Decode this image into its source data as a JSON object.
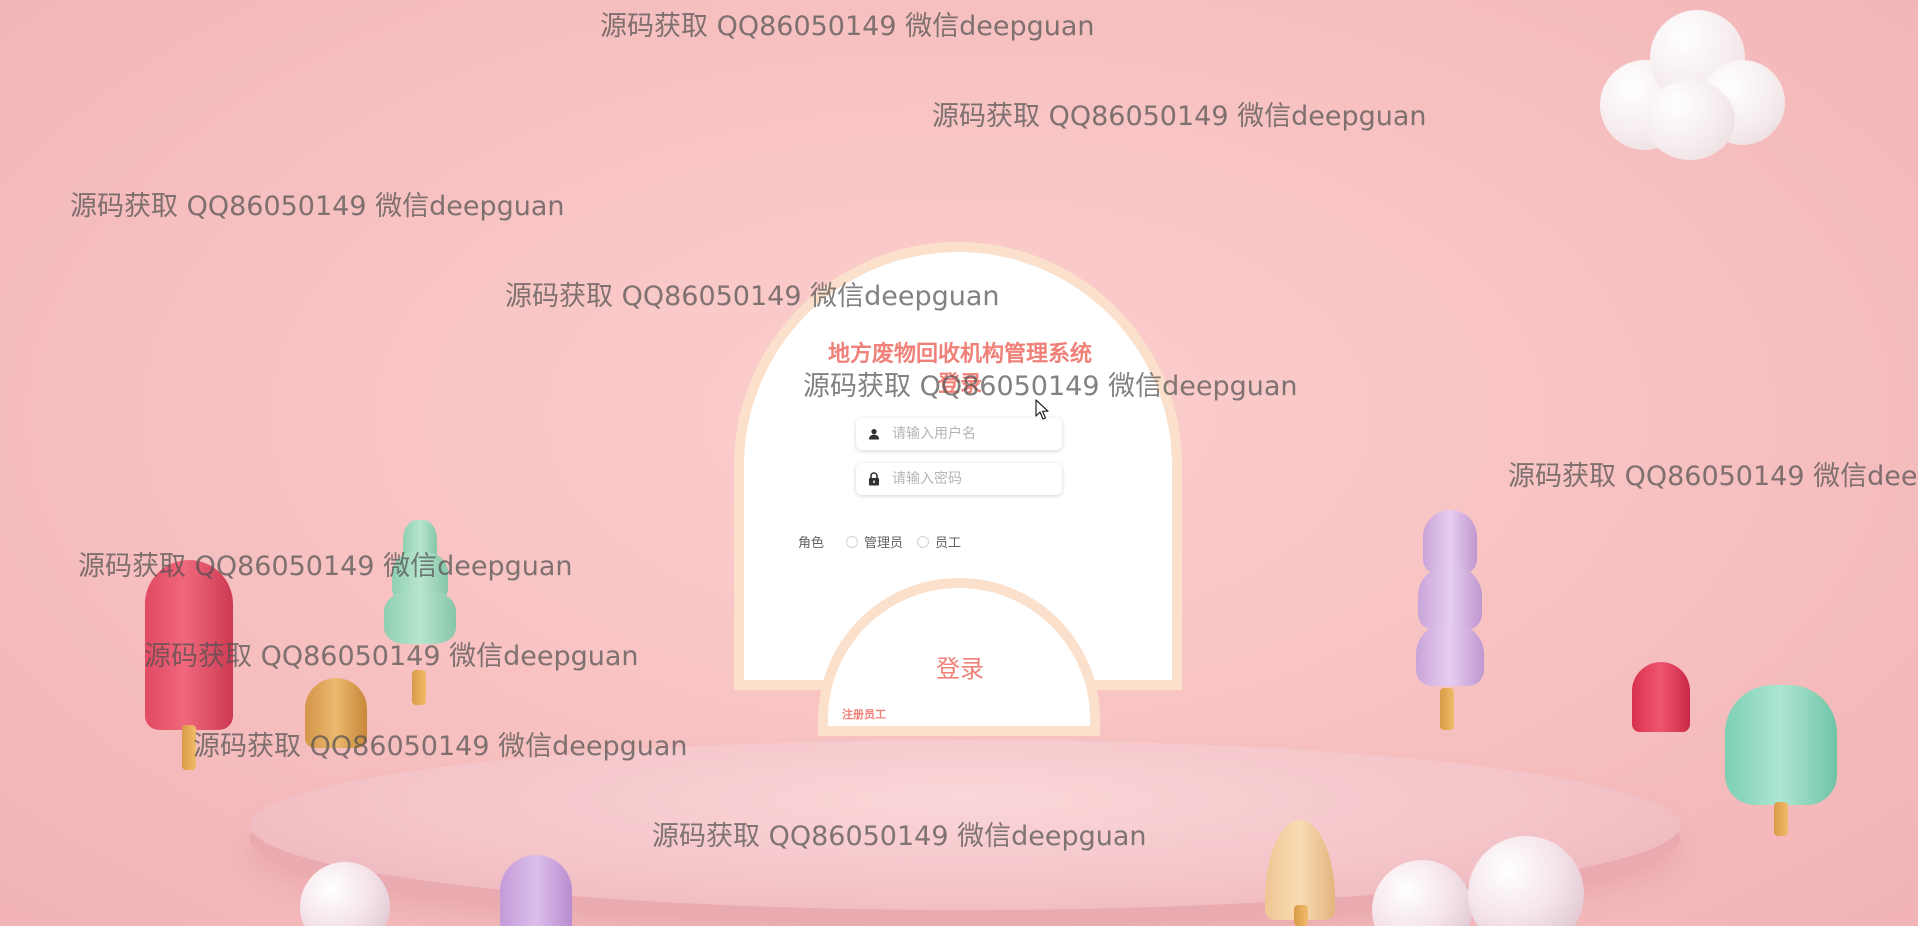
{
  "login": {
    "title": "地方废物回收机构管理系统登录",
    "username_placeholder": "请输入用户名",
    "password_placeholder": "请输入密码",
    "role_label": "角色",
    "roles": [
      "管理员",
      "员工"
    ],
    "login_button": "登录",
    "register_link": "注册员工"
  },
  "watermark": "源码获取 QQ86050149 微信deepguan",
  "colors": {
    "background": "#f8c3c3",
    "accent": "#f08178",
    "arch_border": "#fbe0cc"
  },
  "icons": {
    "username": "user-icon",
    "password": "lock-icon"
  }
}
